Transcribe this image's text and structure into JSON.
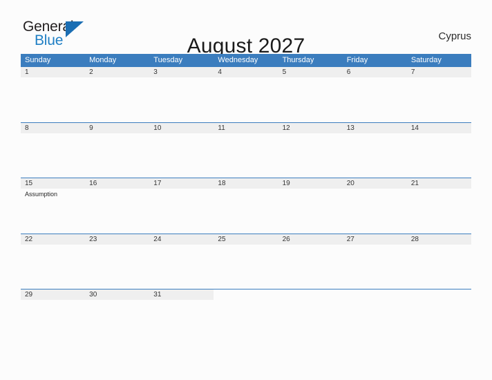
{
  "brand": {
    "name_part1": "General",
    "name_part2": "Blue",
    "triangle_color": "#1b6eb3",
    "blue_text_color": "#1f7fc4"
  },
  "header": {
    "title": "August 2027",
    "country": "Cyprus"
  },
  "theme": {
    "header_blue": "#3b7dbe",
    "band_gray": "#efefef",
    "page_background": "#fcfcfc",
    "text_color": "#333333"
  },
  "calendar": {
    "month": "August",
    "year": "2027",
    "weekday_headers": [
      "Sunday",
      "Monday",
      "Tuesday",
      "Wednesday",
      "Thursday",
      "Friday",
      "Saturday"
    ],
    "weeks": [
      {
        "days": [
          {
            "number": "1",
            "events": []
          },
          {
            "number": "2",
            "events": []
          },
          {
            "number": "3",
            "events": []
          },
          {
            "number": "4",
            "events": []
          },
          {
            "number": "5",
            "events": []
          },
          {
            "number": "6",
            "events": []
          },
          {
            "number": "7",
            "events": []
          }
        ]
      },
      {
        "days": [
          {
            "number": "8",
            "events": []
          },
          {
            "number": "9",
            "events": []
          },
          {
            "number": "10",
            "events": []
          },
          {
            "number": "11",
            "events": []
          },
          {
            "number": "12",
            "events": []
          },
          {
            "number": "13",
            "events": []
          },
          {
            "number": "14",
            "events": []
          }
        ]
      },
      {
        "days": [
          {
            "number": "15",
            "events": [
              "Assumption"
            ]
          },
          {
            "number": "16",
            "events": []
          },
          {
            "number": "17",
            "events": []
          },
          {
            "number": "18",
            "events": []
          },
          {
            "number": "19",
            "events": []
          },
          {
            "number": "20",
            "events": []
          },
          {
            "number": "21",
            "events": []
          }
        ]
      },
      {
        "days": [
          {
            "number": "22",
            "events": []
          },
          {
            "number": "23",
            "events": []
          },
          {
            "number": "24",
            "events": []
          },
          {
            "number": "25",
            "events": []
          },
          {
            "number": "26",
            "events": []
          },
          {
            "number": "27",
            "events": []
          },
          {
            "number": "28",
            "events": []
          }
        ]
      },
      {
        "days": [
          {
            "number": "29",
            "events": []
          },
          {
            "number": "30",
            "events": []
          },
          {
            "number": "31",
            "events": []
          },
          {
            "number": "",
            "events": []
          },
          {
            "number": "",
            "events": []
          },
          {
            "number": "",
            "events": []
          },
          {
            "number": "",
            "events": []
          }
        ]
      }
    ]
  }
}
